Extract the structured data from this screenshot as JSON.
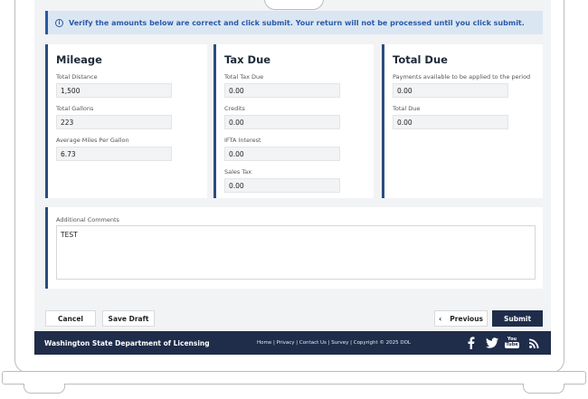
{
  "alert": {
    "text": "Verify the amounts below are correct and click submit. Your return will not be processed until you click submit.",
    "icon": "info-icon"
  },
  "mileage": {
    "title": "Mileage",
    "fields": [
      {
        "label": "Total Distance",
        "value": "1,500"
      },
      {
        "label": "Total Gallons",
        "value": "223"
      },
      {
        "label": "Average Miles Per Gallon",
        "value": "6.73"
      }
    ]
  },
  "tax_due": {
    "title": "Tax Due",
    "fields": [
      {
        "label": "Total Tax Due",
        "value": "0.00"
      },
      {
        "label": "Credits",
        "value": "0.00"
      },
      {
        "label": "IFTA Interest",
        "value": "0.00"
      },
      {
        "label": "Sales Tax",
        "value": "0.00"
      }
    ]
  },
  "total_due": {
    "title": "Total Due",
    "fields": [
      {
        "label": "Payments available to be applied to the period",
        "value": "0.00"
      },
      {
        "label": "Total Due",
        "value": "0.00"
      }
    ]
  },
  "comments": {
    "label": "Additional Comments",
    "value": "TEST"
  },
  "buttons": {
    "cancel": "Cancel",
    "save_draft": "Save Draft",
    "previous": "Previous",
    "previous_icon": "chevron-left-icon",
    "submit": "Submit"
  },
  "footer": {
    "org": "Washington State Department of Licensing",
    "links": "Home | Privacy | Contact Us | Survey | Copyright © 2025 DOL",
    "social": [
      "facebook-icon",
      "twitter-icon",
      "youtube-icon",
      "rss-icon"
    ]
  },
  "colors": {
    "navy": "#1f2d4a",
    "accent": "#2b4d7e",
    "alert_bg": "#dbe6f3",
    "alert_text": "#2a5aa6"
  }
}
